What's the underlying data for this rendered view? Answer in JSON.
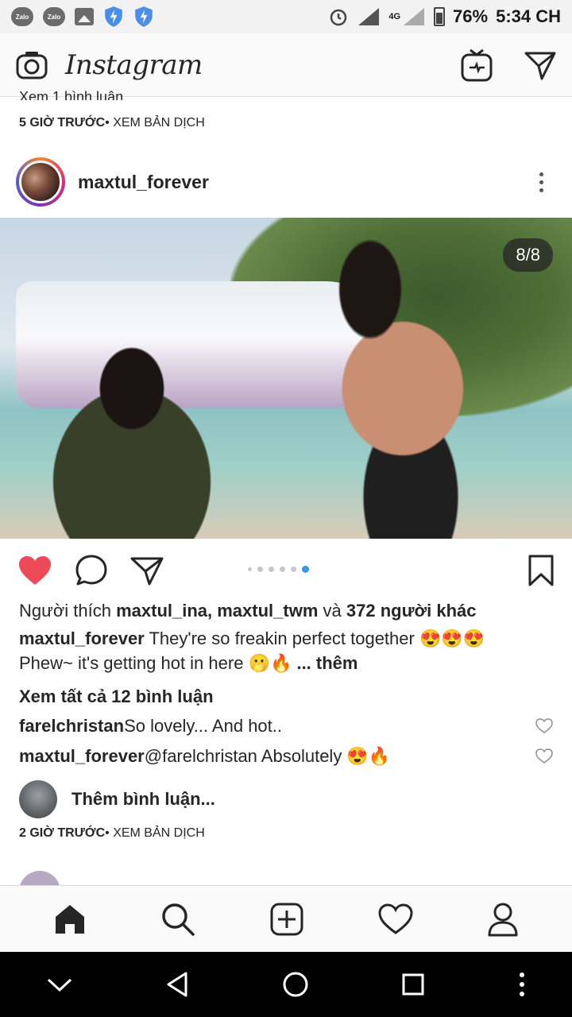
{
  "status_bar": {
    "icons": [
      "zalo-icon",
      "zalo-icon",
      "gallery-icon",
      "shield-icon",
      "shield-icon"
    ],
    "zalo_label": "Zalo",
    "network": "4G",
    "battery": "76%",
    "time": "5:34 CH"
  },
  "app": {
    "logo": "Instagram"
  },
  "feed": {
    "prev_cut_text": "Xem 1 bình luận",
    "prev_time": "5 GIỜ TRƯỚC",
    "prev_translate": "• XEM BẢN DỊCH",
    "post": {
      "username": "maxtul_forever",
      "counter": "8/8",
      "likes_prefix": "Người thích ",
      "likes_names": "maxtul_ina, maxtul_twm",
      "likes_and": " và ",
      "likes_others": "372 người khác",
      "caption_user": "maxtul_forever",
      "caption_text": " They're so freakin perfect together 😍😍😍",
      "caption_line2": "Phew~ it's getting hot in here 🫢🔥",
      "more": " ... thêm",
      "view_all_comments": "Xem tất cả 12 bình luận",
      "comments": [
        {
          "user": "farelchristan",
          "text": " So lovely... And hot.."
        },
        {
          "user": "maxtul_forever",
          "text": " @farelchristan Absolutely 😍🔥"
        }
      ],
      "add_comment_placeholder": "Thêm bình luận...",
      "time": "2 GIỜ TRƯỚC",
      "translate": "• XEM BẢN DỊCH"
    }
  },
  "colors": {
    "like_red": "#ed4956",
    "dot_active": "#3897f0"
  }
}
